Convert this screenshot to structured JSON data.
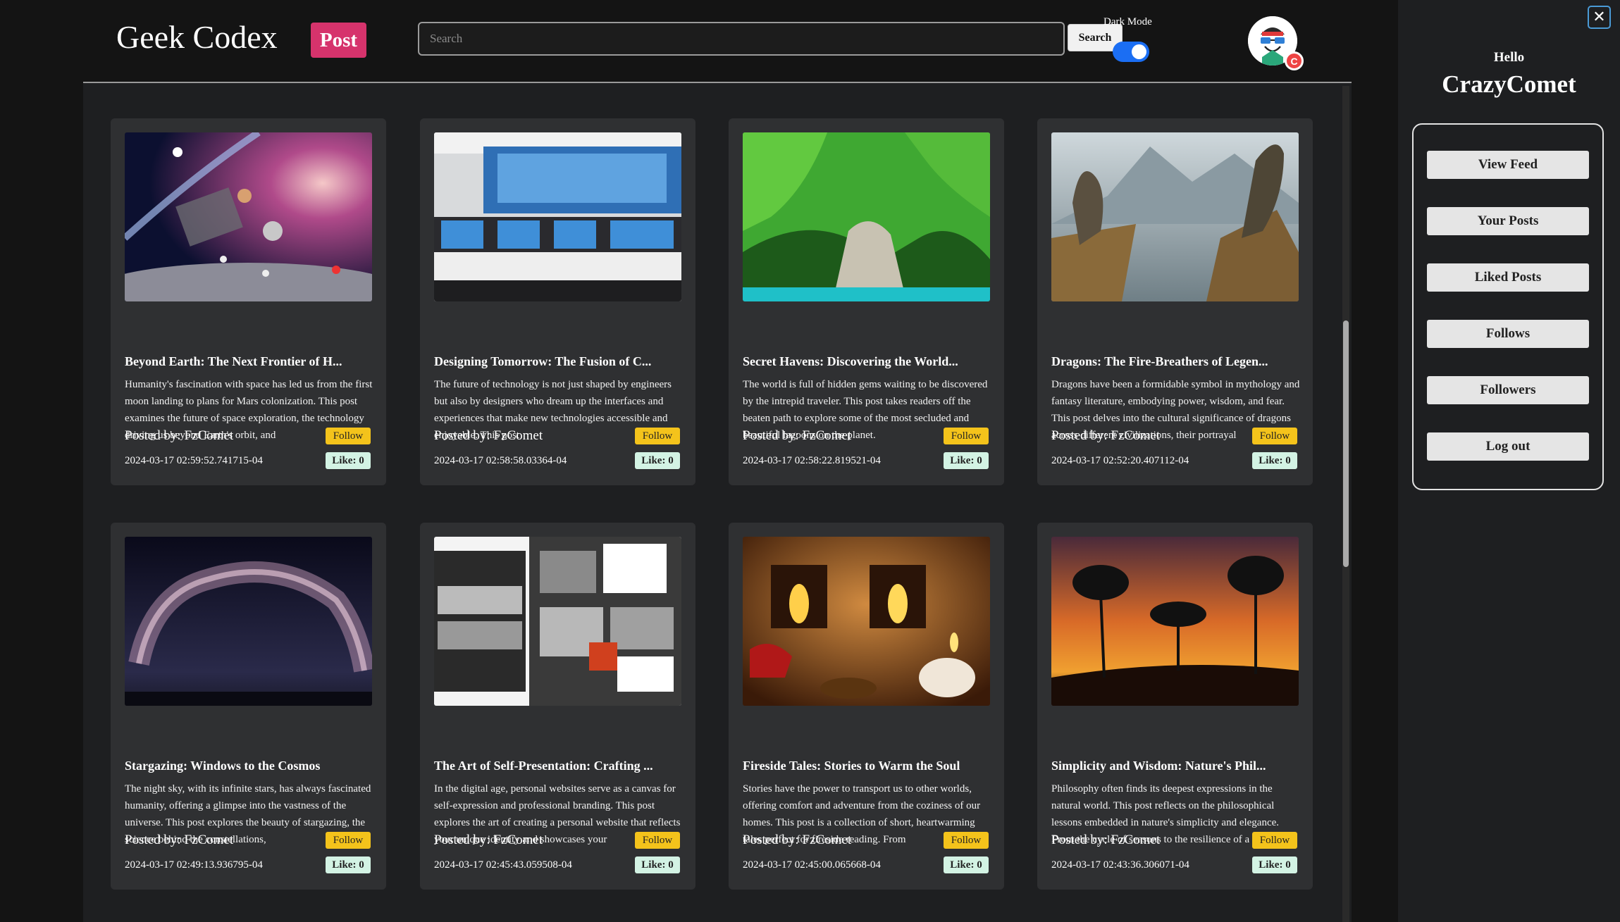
{
  "header": {
    "brand": "Geek Codex",
    "post_label": "Post",
    "search_placeholder": "Search",
    "search_label": "Search",
    "dark_mode_label": "Dark Mode",
    "avatar_badge": "C"
  },
  "sidebar": {
    "greeting": "Hello",
    "username": "CrazyComet",
    "close_label": "✕",
    "menu": [
      "View Feed",
      "Your Posts",
      "Liked Posts",
      "Follows",
      "Followers",
      "Log out"
    ]
  },
  "posts": [
    {
      "title": "Beyond Earth: The Next Frontier of H...",
      "description": "Humanity's fascination with space has led us from the first moon landing to plans for Mars colonization. This post examines the future of space exploration, the technology driving us beyond Earth's orbit, and",
      "author": "Posted by: FzComet",
      "follow": "Follow",
      "date": "2024-03-17 02:59:52.741715-04",
      "likes": "Like: 0",
      "image": "space-exploration-image"
    },
    {
      "title": "Designing Tomorrow: The Fusion of C...",
      "description": "The future of technology is not just shaped by engineers but also by designers who dream up the interfaces and experiences that make new technologies accessible and enjoyable. This post",
      "author": "Posted by: FzComet",
      "follow": "Follow",
      "date": "2024-03-17 02:58:58.03364-04",
      "likes": "Like: 0",
      "image": "tech-office-image"
    },
    {
      "title": "Secret Havens: Discovering the World...",
      "description": "The world is full of hidden gems waiting to be discovered by the intrepid traveler. This post takes readers off the beaten path to explore some of the most secluded and beautiful lagoons on the planet.",
      "author": "Posted by: FzComet",
      "follow": "Follow",
      "date": "2024-03-17 02:58:22.819521-04",
      "likes": "Like: 0",
      "image": "lagoon-image"
    },
    {
      "title": "Dragons: The Fire-Breathers of Legen...",
      "description": "Dragons have been a formidable symbol in mythology and fantasy literature, embodying power, wisdom, and fear. This post delves into the cultural significance of dragons across different civilizations, their portrayal",
      "author": "Posted by: FzComet",
      "follow": "Follow",
      "date": "2024-03-17 02:52:20.407112-04",
      "likes": "Like: 0",
      "image": "dragons-image"
    },
    {
      "title": "Stargazing: Windows to the Cosmos",
      "description": "The night sky, with its infinite stars, has always fascinated humanity, offering a glimpse into the vastness of the universe. This post explores the beauty of stargazing, the science behind the constellations,",
      "author": "Posted by: FzComet",
      "follow": "Follow",
      "date": "2024-03-17 02:49:13.936795-04",
      "likes": "Like: 0",
      "image": "milky-way-image"
    },
    {
      "title": "The Art of Self-Presentation: Crafting ...",
      "description": "In the digital age, personal websites serve as a canvas for self-expression and professional branding. This post explores the art of creating a personal website that reflects your unique identity and showcases your",
      "author": "Posted by: FzComet",
      "follow": "Follow",
      "date": "2024-03-17 02:45:43.059508-04",
      "likes": "Like: 0",
      "image": "website-collage-image"
    },
    {
      "title": "Fireside Tales: Stories to Warm the Soul",
      "description": "Stories have the power to transport us to other worlds, offering comfort and adventure from the coziness of our homes. This post is a collection of short, heartwarming tales perfect for fireside reading. From",
      "author": "Posted by: FzComet",
      "follow": "Follow",
      "date": "2024-03-17 02:45:00.065668-04",
      "likes": "Like: 0",
      "image": "fireplace-image"
    },
    {
      "title": "Simplicity and Wisdom: Nature's Phil...",
      "description": "Philosophy often finds its deepest expressions in the natural world. This post reflects on the philosophical lessons embedded in nature's simplicity and elegance. From the cycle of seasons to the resilience of a lone",
      "author": "Posted by: FzComet",
      "follow": "Follow",
      "date": "2024-03-17 02:43:36.306071-04",
      "likes": "Like: 0",
      "image": "sunset-trees-image"
    }
  ],
  "colors": {
    "accent_post": "#d6336c",
    "follow": "#f4c31b",
    "like": "#d3f3e4",
    "toggle_on": "#1b6ef3"
  }
}
